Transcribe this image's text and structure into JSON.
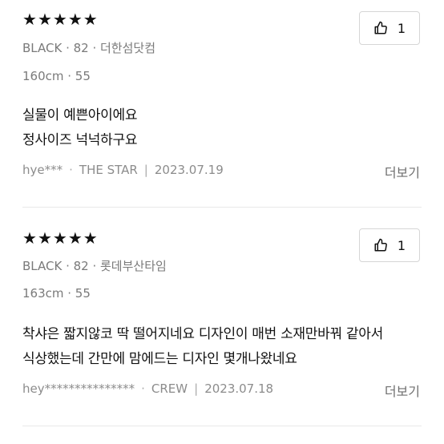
{
  "reviews": [
    {
      "stars": [
        "★",
        "★",
        "★",
        "★",
        "★"
      ],
      "likes": "1",
      "options": "BLACK · 82 · 더한섬닷컴",
      "body_info": "160cm · 55",
      "content_lines": [
        "실물이 예쁜아이에요",
        "정사이즈 넉넉하구요"
      ],
      "author": "hye***",
      "shop": "THE STAR",
      "date": "2023.07.19",
      "more_label": "더보기"
    },
    {
      "stars": [
        "★",
        "★",
        "★",
        "★",
        "★"
      ],
      "likes": "1",
      "options": "BLACK · 82 · 롯데부산타임",
      "body_info": "163cm · 55",
      "content_lines": [
        "착샤은 짧지않코 딱 떨어지네요 디자인이 매번 소재만바꿔 같아서",
        "식상했는데 간만에 맘에드는 디자인 몇개나왔네요"
      ],
      "author": "hey***************",
      "shop": "CREW",
      "date": "2023.07.18",
      "more_label": "더보기"
    }
  ],
  "icons": {
    "like": "thumbs-up-icon",
    "rating": "star-icon"
  },
  "colors": {
    "star": "#111111",
    "meta": "#8c8c8c",
    "divider": "#e8e8e8"
  }
}
